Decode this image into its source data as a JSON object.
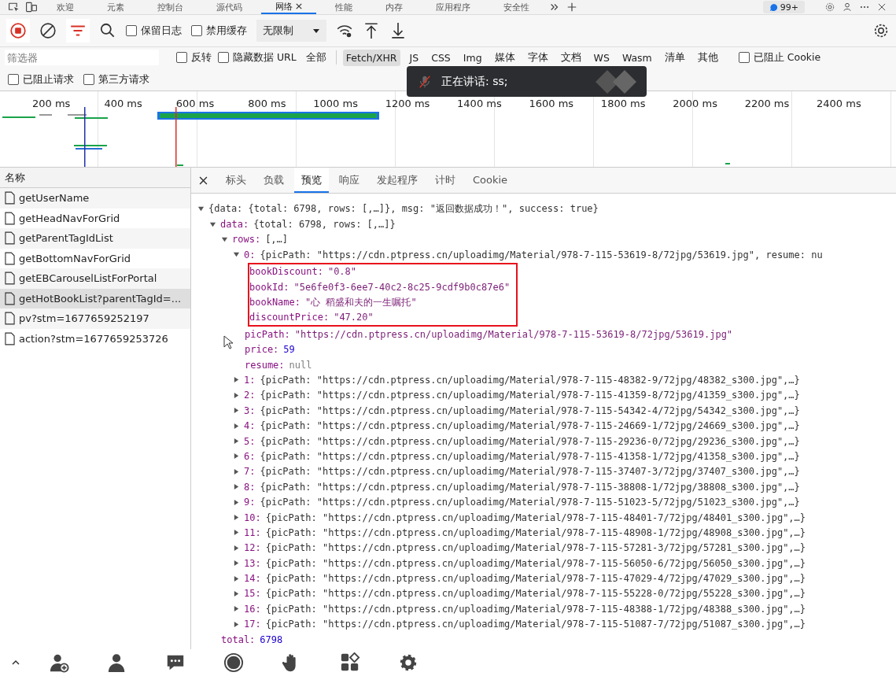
{
  "devtools_tabs": [
    {
      "label": "欢迎",
      "selected": false,
      "closable": false
    },
    {
      "label": "元素",
      "selected": false,
      "closable": false
    },
    {
      "label": "控制台",
      "selected": false,
      "closable": false
    },
    {
      "label": "源代码",
      "selected": false,
      "closable": false
    },
    {
      "label": "网络",
      "selected": true,
      "closable": true
    },
    {
      "label": "性能",
      "selected": false,
      "closable": false
    },
    {
      "label": "内存",
      "selected": false,
      "closable": false
    },
    {
      "label": "应用程序",
      "selected": false,
      "closable": false
    },
    {
      "label": "安全性",
      "selected": false,
      "closable": false
    }
  ],
  "issues_badge": "99+",
  "toolbar": {
    "recording": true,
    "filter_active": true,
    "preserve_log": {
      "label": "保留日志",
      "checked": false
    },
    "disable_cache": {
      "label": "禁用缓存",
      "checked": false
    },
    "throttling": "无限制"
  },
  "filter_bar": {
    "placeholder": "筛选器",
    "options": [
      {
        "label": "反转",
        "checked": false
      },
      {
        "label": "隐藏数据 URL",
        "checked": false
      }
    ],
    "types": [
      {
        "label": "全部",
        "selected": false
      },
      {
        "label": "Fetch/XHR",
        "selected": true
      },
      {
        "label": "JS",
        "selected": false
      },
      {
        "label": "CSS",
        "selected": false
      },
      {
        "label": "Img",
        "selected": false
      },
      {
        "label": "媒体",
        "selected": false
      },
      {
        "label": "字体",
        "selected": false
      },
      {
        "label": "文档",
        "selected": false
      },
      {
        "label": "WS",
        "selected": false
      },
      {
        "label": "Wasm",
        "selected": false
      },
      {
        "label": "清单",
        "selected": false
      },
      {
        "label": "其他",
        "selected": false
      }
    ],
    "blocked_cookies": {
      "label": "已阻止 Cookie",
      "checked": false
    },
    "second_row": [
      {
        "label": "已阻止请求",
        "checked": false
      },
      {
        "label": "第三方请求",
        "checked": false
      }
    ]
  },
  "toast": {
    "text": "正在讲话: ss;",
    "muted": true
  },
  "waterfall": {
    "ticks": [
      "200 ms",
      "400 ms",
      "600 ms",
      "800 ms",
      "1000 ms",
      "1200 ms",
      "1400 ms",
      "1600 ms",
      "1800 ms",
      "2000 ms",
      "2200 ms",
      "2400 ms"
    ]
  },
  "requests": {
    "header": "名称",
    "items": [
      {
        "name": "getUserName",
        "selected": false
      },
      {
        "name": "getHeadNavForGrid",
        "selected": false
      },
      {
        "name": "getParentTagIdList",
        "selected": false
      },
      {
        "name": "getBottomNavForGrid",
        "selected": false
      },
      {
        "name": "getEBCarouselListForPortal",
        "selected": false
      },
      {
        "name": "getHotBookList?parentTagId=...",
        "selected": true
      },
      {
        "name": "pv?stm=1677659252197",
        "selected": false
      },
      {
        "name": "action?stm=1677659253726",
        "selected": false
      }
    ]
  },
  "detail_tabs": [
    {
      "label": "标头",
      "selected": false
    },
    {
      "label": "负载",
      "selected": false
    },
    {
      "label": "预览",
      "selected": true
    },
    {
      "label": "响应",
      "selected": false
    },
    {
      "label": "发起程序",
      "selected": false
    },
    {
      "label": "计时",
      "selected": false
    },
    {
      "label": "Cookie",
      "selected": false
    }
  ],
  "tree": {
    "summary": "{data: {total: 6798, rows: [,…]}, msg: \"返回数据成功！\", success: true}",
    "expanded": true,
    "children": [
      {
        "key": "data:",
        "summary": "{total: 6798, rows: [,…]}",
        "expanded": true,
        "children": [
          {
            "key": "rows:",
            "summary": "[,…]",
            "expanded": true,
            "children": [
              {
                "key": "0:",
                "summary": "{picPath: \"https://cdn.ptpress.cn/uploadimg/Material/978-7-115-53619-8/72jpg/53619.jpg\", resume: nu",
                "expanded": true,
                "children": [
                  {
                    "key": "bookDiscount:",
                    "value": "\"0.8\"",
                    "kind": "string",
                    "highlighted": true
                  },
                  {
                    "key": "bookId:",
                    "value": "\"5e6fe0f3-6ee7-40c2-8c25-9cdf9b0c87e6\"",
                    "kind": "string",
                    "highlighted": true
                  },
                  {
                    "key": "bookName:",
                    "value": "\"心 稻盛和夫的一生嘱托\"",
                    "kind": "string",
                    "highlighted": true
                  },
                  {
                    "key": "discountPrice:",
                    "value": "\"47.20\"",
                    "kind": "string",
                    "highlighted": true
                  },
                  {
                    "key": "picPath:",
                    "value": "\"https://cdn.ptpress.cn/uploadimg/Material/978-7-115-53619-8/72jpg/53619.jpg\"",
                    "kind": "string",
                    "highlighted": false
                  },
                  {
                    "key": "price:",
                    "value": "59",
                    "kind": "number",
                    "highlighted": false
                  },
                  {
                    "key": "resume:",
                    "value": "null",
                    "kind": "null",
                    "highlighted": false
                  }
                ]
              },
              {
                "key": "1:",
                "summary": "{picPath: \"https://cdn.ptpress.cn/uploadimg/Material/978-7-115-48382-9/72jpg/48382_s300.jpg\",…}",
                "expanded": false
              },
              {
                "key": "2:",
                "summary": "{picPath: \"https://cdn.ptpress.cn/uploadimg/Material/978-7-115-41359-8/72jpg/41359_s300.jpg\",…}",
                "expanded": false
              },
              {
                "key": "3:",
                "summary": "{picPath: \"https://cdn.ptpress.cn/uploadimg/Material/978-7-115-54342-4/72jpg/54342_s300.jpg\",…}",
                "expanded": false
              },
              {
                "key": "4:",
                "summary": "{picPath: \"https://cdn.ptpress.cn/uploadimg/Material/978-7-115-24669-1/72jpg/24669_s300.jpg\",…}",
                "expanded": false
              },
              {
                "key": "5:",
                "summary": "{picPath: \"https://cdn.ptpress.cn/uploadimg/Material/978-7-115-29236-0/72jpg/29236_s300.jpg\",…}",
                "expanded": false
              },
              {
                "key": "6:",
                "summary": "{picPath: \"https://cdn.ptpress.cn/uploadimg/Material/978-7-115-41358-1/72jpg/41358_s300.jpg\",…}",
                "expanded": false
              },
              {
                "key": "7:",
                "summary": "{picPath: \"https://cdn.ptpress.cn/uploadimg/Material/978-7-115-37407-3/72jpg/37407_s300.jpg\",…}",
                "expanded": false
              },
              {
                "key": "8:",
                "summary": "{picPath: \"https://cdn.ptpress.cn/uploadimg/Material/978-7-115-38808-1/72jpg/38808_s300.jpg\",…}",
                "expanded": false
              },
              {
                "key": "9:",
                "summary": "{picPath: \"https://cdn.ptpress.cn/uploadimg/Material/978-7-115-51023-5/72jpg/51023_s300.jpg\",…}",
                "expanded": false
              },
              {
                "key": "10:",
                "summary": "{picPath: \"https://cdn.ptpress.cn/uploadimg/Material/978-7-115-48401-7/72jpg/48401_s300.jpg\",…}",
                "expanded": false
              },
              {
                "key": "11:",
                "summary": "{picPath: \"https://cdn.ptpress.cn/uploadimg/Material/978-7-115-48908-1/72jpg/48908_s300.jpg\",…}",
                "expanded": false
              },
              {
                "key": "12:",
                "summary": "{picPath: \"https://cdn.ptpress.cn/uploadimg/Material/978-7-115-57281-3/72jpg/57281_s300.jpg\",…}",
                "expanded": false
              },
              {
                "key": "13:",
                "summary": "{picPath: \"https://cdn.ptpress.cn/uploadimg/Material/978-7-115-56050-6/72jpg/56050_s300.jpg\",…}",
                "expanded": false
              },
              {
                "key": "14:",
                "summary": "{picPath: \"https://cdn.ptpress.cn/uploadimg/Material/978-7-115-47029-4/72jpg/47029_s300.jpg\",…}",
                "expanded": false
              },
              {
                "key": "15:",
                "summary": "{picPath: \"https://cdn.ptpress.cn/uploadimg/Material/978-7-115-55228-0/72jpg/55228_s300.jpg\",…}",
                "expanded": false
              },
              {
                "key": "16:",
                "summary": "{picPath: \"https://cdn.ptpress.cn/uploadimg/Material/978-7-115-48388-1/72jpg/48388_s300.jpg\",…}",
                "expanded": false
              },
              {
                "key": "17:",
                "summary": "{picPath: \"https://cdn.ptpress.cn/uploadimg/Material/978-7-115-51087-7/72jpg/51087_s300.jpg\",…}",
                "expanded": false
              }
            ]
          },
          {
            "key": "total:",
            "value": "6798",
            "kind": "number",
            "highlighted": false
          }
        ]
      }
    ]
  }
}
